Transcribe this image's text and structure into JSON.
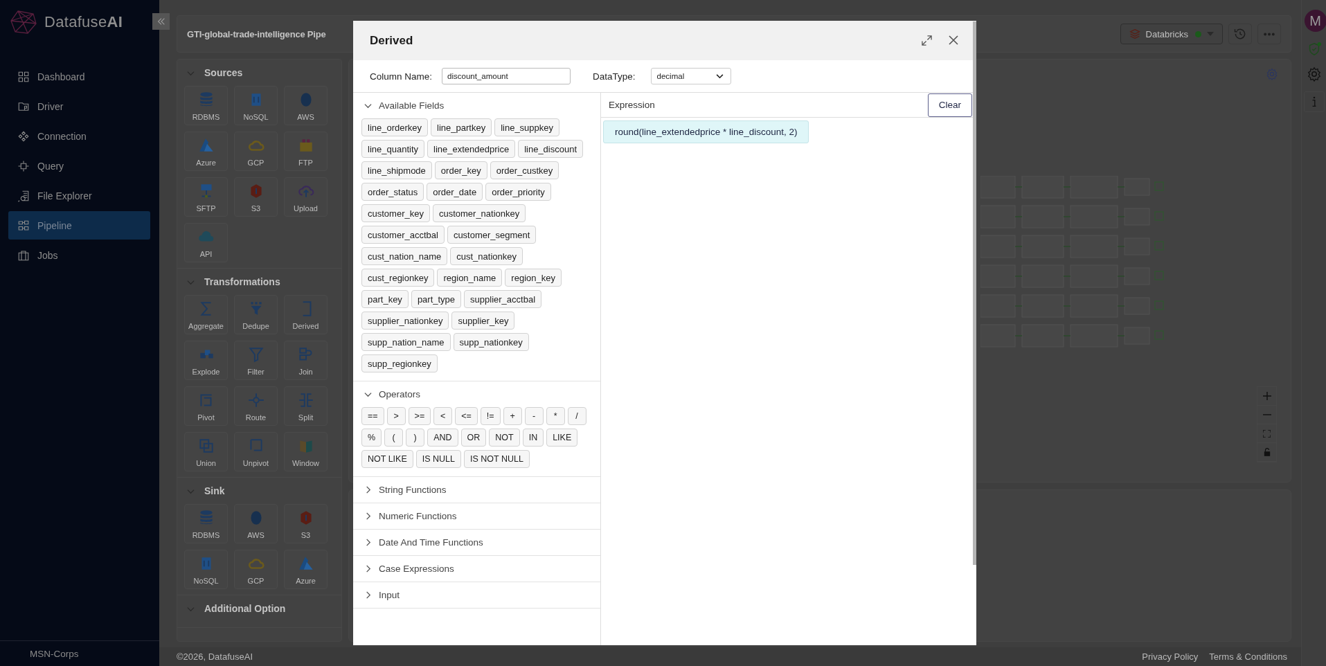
{
  "sidebar": {
    "brand": "Datafuse**AI**",
    "items": [
      {
        "label": "Dashboard",
        "selected": false
      },
      {
        "label": "Driver",
        "selected": false
      },
      {
        "label": "Connection",
        "selected": false
      },
      {
        "label": "Query",
        "selected": false
      },
      {
        "label": "File Explorer",
        "selected": false
      },
      {
        "label": "Pipeline",
        "selected": true
      },
      {
        "label": "Jobs",
        "selected": false
      }
    ],
    "footer": "MSN-Corps"
  },
  "pipeline": {
    "title": "GTI-global-trade-intelligence Pipe",
    "engine": {
      "label": "Databricks",
      "connected": true
    }
  },
  "user": {
    "initial": "M"
  },
  "palette": {
    "sections": [
      {
        "title": "Sources",
        "expanded": true,
        "items": [
          "RDBMS",
          "NoSQL",
          "AWS",
          "Azure",
          "GCP",
          "FTP",
          "SFTP",
          "S3",
          "Upload",
          "API"
        ]
      },
      {
        "title": "Transformations",
        "expanded": true,
        "items": [
          "Aggregate",
          "Dedupe",
          "Derived",
          "Explode",
          "Filter",
          "Join",
          "Pivot",
          "Route",
          "Split",
          "Union",
          "Unpivot",
          "Window"
        ]
      },
      {
        "title": "Sink",
        "expanded": true,
        "items": [
          "RDBMS",
          "AWS",
          "S3",
          "NoSQL",
          "GCP",
          "Azure"
        ]
      },
      {
        "title": "Additional Option",
        "expanded": true
      }
    ]
  },
  "dialog": {
    "title": "Derived",
    "column_name_label": "Column Name:",
    "column_name": "discount_amount",
    "datatype_label": "DataType:",
    "datatype": "decimal",
    "sections": [
      {
        "title": "Available Fields",
        "expanded": true,
        "items": [
          "line_orderkey",
          "line_partkey",
          "line_suppkey",
          "line_quantity",
          "line_extendedprice",
          "line_discount",
          "line_shipmode",
          "order_key",
          "order_custkey",
          "order_status",
          "order_date",
          "order_priority",
          "customer_key",
          "customer_nationkey",
          "customer_acctbal",
          "customer_segment",
          "cust_nation_name",
          "cust_nationkey",
          "cust_regionkey",
          "region_name",
          "region_key",
          "part_key",
          "part_type",
          "supplier_acctbal",
          "supplier_nationkey",
          "supplier_key",
          "supp_nation_name",
          "supp_nationkey",
          "supp_regionkey"
        ]
      },
      {
        "title": "Operators",
        "expanded": true,
        "items": [
          "==",
          ">",
          ">=",
          "<",
          "<=",
          "!=",
          "+",
          "-",
          "*",
          "/",
          "%",
          "(",
          ")",
          "AND",
          "OR",
          "NOT",
          "IN",
          "LIKE",
          "NOT LIKE",
          "IS NULL",
          "IS NOT NULL"
        ]
      },
      {
        "title": "String Functions",
        "expanded": false
      },
      {
        "title": "Numeric Functions",
        "expanded": false
      },
      {
        "title": "Date And Time Functions",
        "expanded": false
      },
      {
        "title": "Case Expressions",
        "expanded": false
      },
      {
        "title": "Input",
        "expanded": false
      }
    ],
    "expression_label": "Expression",
    "clear_button": "Clear",
    "expression": "round(line_extendedprice * line_discount, 2)"
  },
  "footer": {
    "copyright": "©2026, DatafuseAI",
    "links": [
      "Privacy Policy",
      "Terms & Conditions"
    ]
  }
}
